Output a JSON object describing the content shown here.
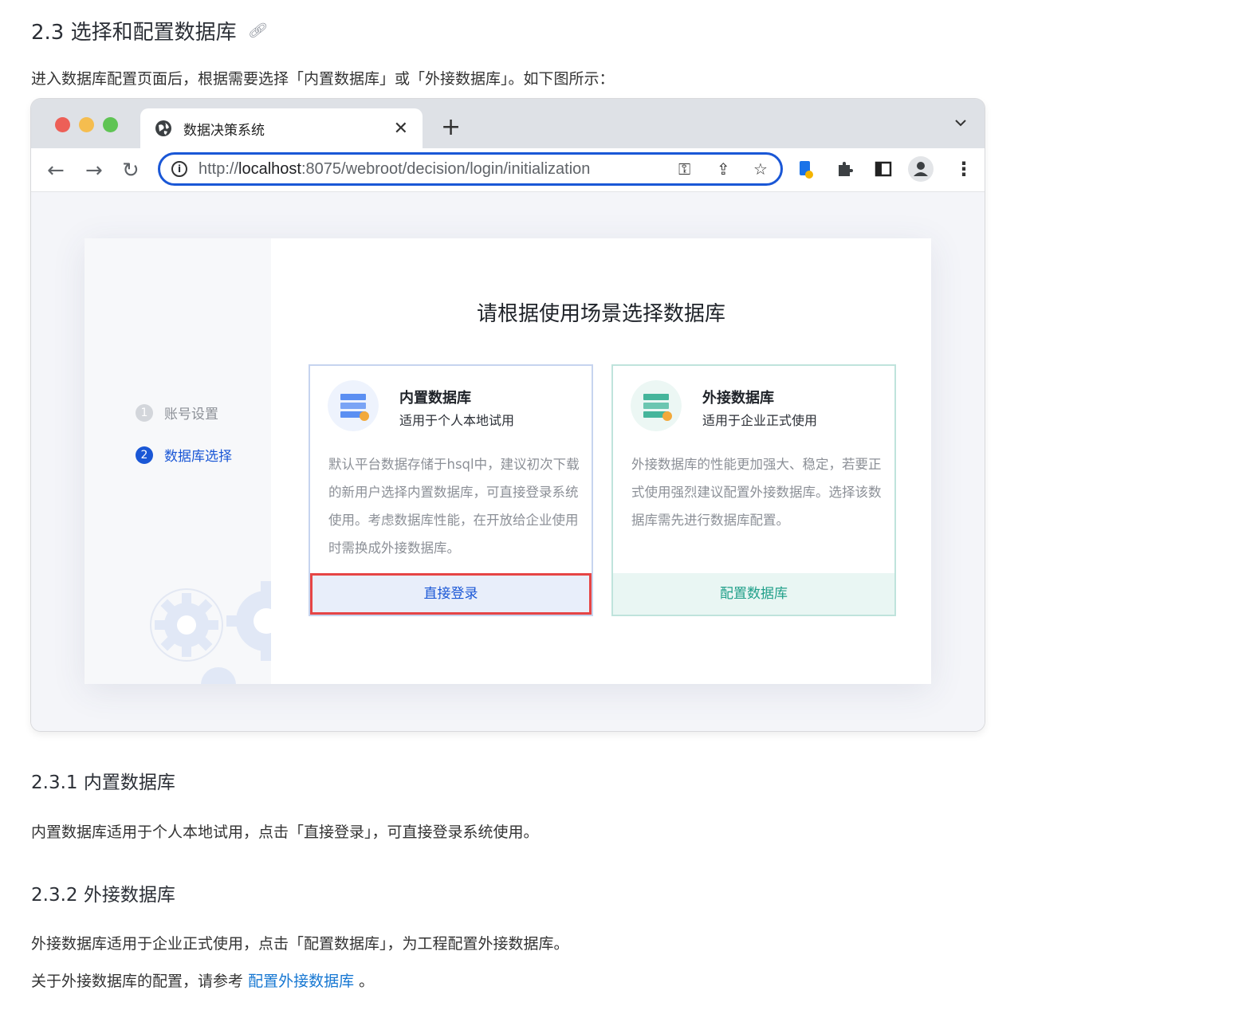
{
  "section": {
    "heading": "2.3 选择和配置数据库",
    "anchor_icon": "link-icon",
    "intro": "进入数据库配置页面后，根据需要选择「内置数据库」或「外接数据库」。如下图所示："
  },
  "browser": {
    "tab_title": "数据决策系统",
    "url_prefix": "http://",
    "url_host": "localhost",
    "url_rest": ":8075/webroot/decision/login/initialization",
    "page": {
      "title": "请根据使用场景选择数据库",
      "steps": [
        {
          "num": "1",
          "label": "账号设置"
        },
        {
          "num": "2",
          "label": "数据库选择"
        }
      ],
      "options": [
        {
          "name": "内置数据库",
          "subtitle": "适用于个人本地试用",
          "desc": "默认平台数据存储于hsql中，建议初次下载的新用户选择内置数据库，可直接登录系统使用。考虑数据库性能，在开放给企业使用时需换成外接数据库。",
          "action": "直接登录",
          "color": "#1a57d6"
        },
        {
          "name": "外接数据库",
          "subtitle": "适用于企业正式使用",
          "desc": "外接数据库的性能更加强大、稳定，若要正式使用强烈建议配置外接数据库。选择该数据库需先进行数据库配置。",
          "action": "配置数据库",
          "color": "#21a08a"
        }
      ]
    }
  },
  "sub1": {
    "heading": "2.3.1 内置数据库",
    "text": "内置数据库适用于个人本地试用，点击「直接登录」，可直接登录系统使用。"
  },
  "sub2": {
    "heading": "2.3.2 外接数据库",
    "text": "外接数据库适用于企业正式使用，点击「配置数据库」，为工程配置外接数据库。",
    "ref_prefix": "关于外接数据库的配置，请参考",
    "ref_link": "配置外接数据库",
    "ref_suffix": "。"
  }
}
